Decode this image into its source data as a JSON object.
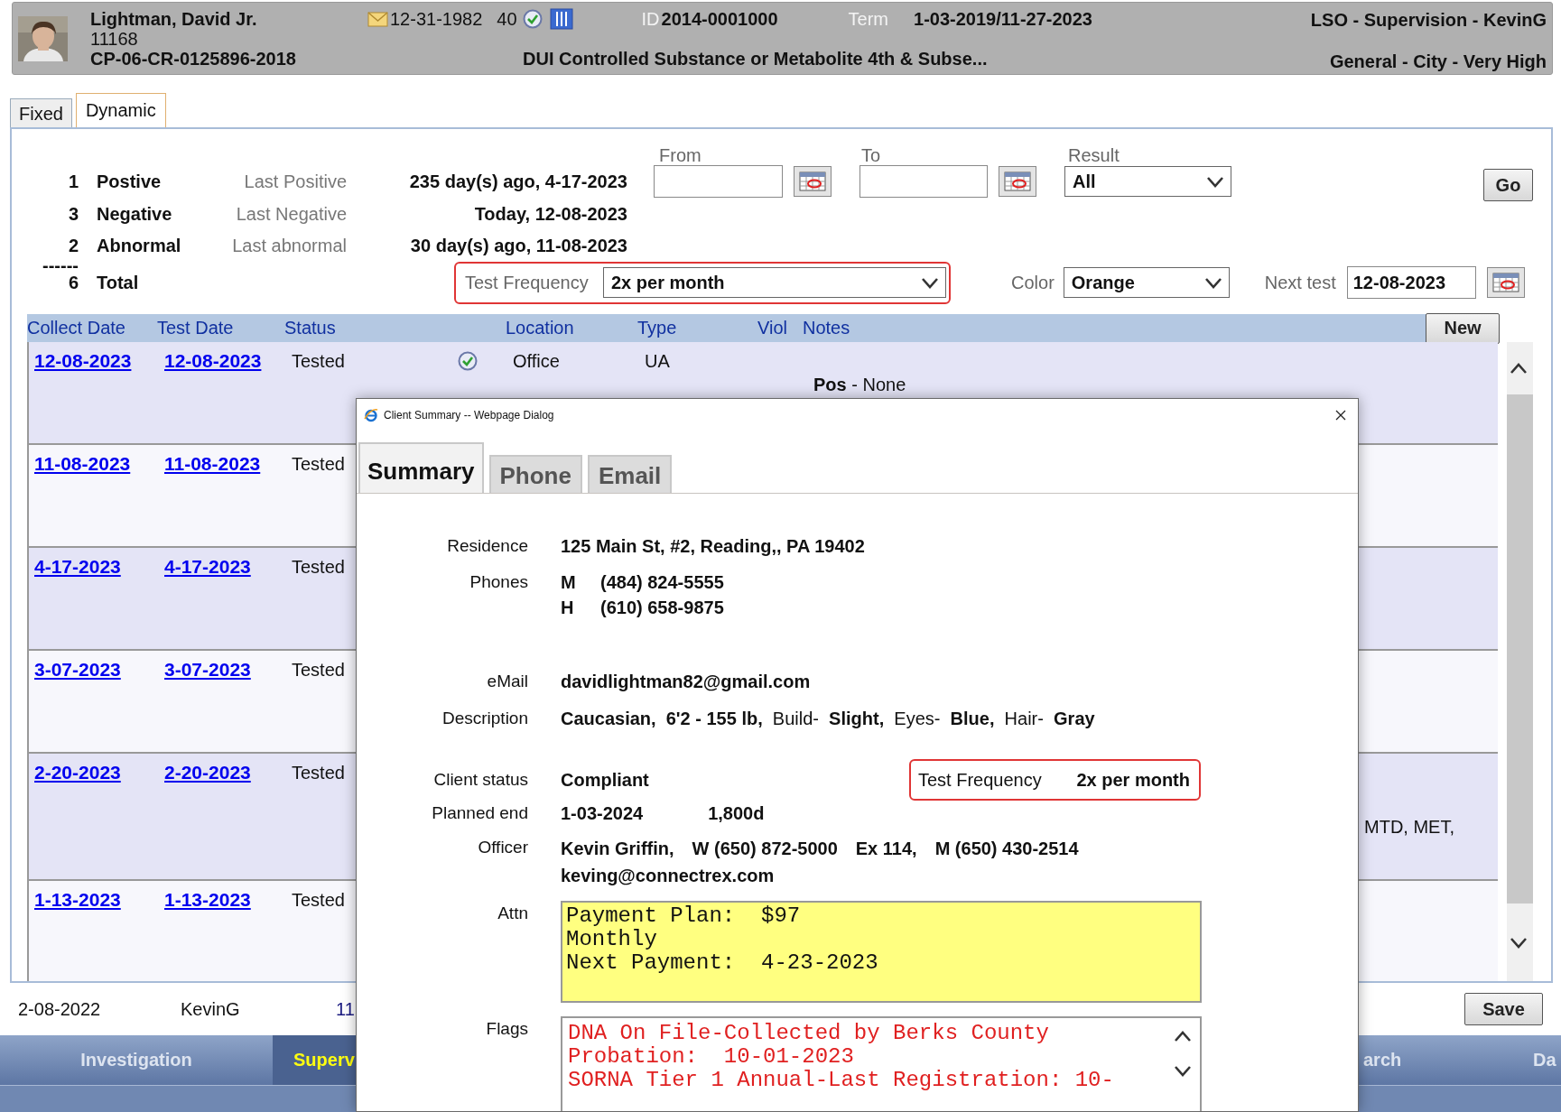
{
  "header": {
    "name": "Lightman, David Jr.",
    "number": "11168",
    "case_number": "CP-06-CR-0125896-2018",
    "birth_date": "12-31-1982",
    "age": "40",
    "id_label": "ID",
    "id": "2014-0001000",
    "term_label": "Term",
    "term": "1-03-2019/11-27-2023",
    "assignment": "LSO - Supervision - KevinG",
    "offense": "DUI Controlled Substance or Metabolite 4th & Subse...",
    "classification": "General - City - Very High"
  },
  "tabs": [
    {
      "label": "Fixed",
      "selected": false
    },
    {
      "label": "Dynamic",
      "selected": true
    }
  ],
  "stats": [
    {
      "count": "1",
      "label": "Postive",
      "last_label": "Last Positive",
      "last_value": "235 day(s) ago, 4-17-2023"
    },
    {
      "count": "3",
      "label": "Negative",
      "last_label": "Last Negative",
      "last_value": "Today, 12-08-2023"
    },
    {
      "count": "2",
      "label": "Abnormal",
      "last_label": "Last abnormal",
      "last_value": "30 day(s) ago, 11-08-2023"
    }
  ],
  "total": {
    "rule": "------",
    "count": "6",
    "label": "Total"
  },
  "filters": {
    "from": {
      "label": "From"
    },
    "to": {
      "label": "To"
    },
    "result": {
      "label": "Result",
      "value": "All"
    },
    "go_button": "Go",
    "test_frequency": {
      "label": "Test Frequency",
      "value": "2x per month",
      "highlighted": true
    },
    "color": {
      "label": "Color",
      "value": "Orange"
    },
    "next_test": {
      "label": "Next test",
      "value": "12-08-2023"
    }
  },
  "table": {
    "columns": [
      "Collect Date",
      "Test Date",
      "Status",
      "Location",
      "Type",
      "Viol",
      "Notes"
    ],
    "new_button": "New",
    "rows": [
      {
        "collect_date": "12-08-2023",
        "test_date": "12-08-2023",
        "status": "Tested",
        "verified": true,
        "location": "Office",
        "type": "UA",
        "notes": "**Pos** - None"
      },
      {
        "collect_date": "11-08-2023",
        "test_date": "11-08-2023",
        "status": "Tested"
      },
      {
        "collect_date": "4-17-2023",
        "test_date": "4-17-2023",
        "status": "Tested"
      },
      {
        "collect_date": "3-07-2023",
        "test_date": "3-07-2023",
        "status": "Tested"
      },
      {
        "collect_date": "2-20-2023",
        "test_date": "2-20-2023",
        "status": "Tested",
        "notes_tail": "MTD, MET,"
      },
      {
        "collect_date": "1-13-2023",
        "test_date": "1-13-2023",
        "status": "Tested"
      }
    ]
  },
  "footer_row": {
    "date": "2-08-2022",
    "user": "KevinG",
    "column_3": "11"
  },
  "save_button": "Save",
  "nav": [
    {
      "label": "Investigation",
      "selected": false
    },
    {
      "label": "Superv",
      "selected": true
    },
    {
      "label": "arch",
      "selected": false
    },
    {
      "label": "Da",
      "selected": false
    }
  ],
  "dialog": {
    "title": "Client Summary -- Webpage Dialog",
    "tabs": [
      {
        "label": "Summary",
        "selected": true
      },
      {
        "label": "Phone",
        "selected": false
      },
      {
        "label": "Email",
        "selected": false
      }
    ],
    "residence": {
      "label": "Residence",
      "value": "125 Main St, #2, Reading,, PA 19402"
    },
    "phones": {
      "label": "Phones",
      "items": [
        {
          "type": "M",
          "number": "(484) 824-5555"
        },
        {
          "type": "H",
          "number": "(610) 658-9875"
        }
      ]
    },
    "email": {
      "label": "eMail",
      "value": "davidlightman82@gmail.com"
    },
    "description": {
      "label": "Description",
      "value": "**Caucasian,  6'2 - 155 lb,**  Build-  **Slight,**  Eyes-  **Blue,**  Hair-  **Gray**"
    },
    "client_status": {
      "label": "Client status",
      "value": "Compliant"
    },
    "test_frequency": {
      "label": "Test Frequency",
      "value": "2x per month",
      "highlighted": true
    },
    "planned_end": {
      "label": "Planned end",
      "date": "1-03-2024",
      "days": "1,800d"
    },
    "officer": {
      "label": "Officer",
      "parts": [
        "Kevin Griffin,",
        "W (650) 872-5000",
        "Ex 114,",
        "M (650) 430-2514"
      ],
      "email": "keving@connectrex.com"
    },
    "attn": {
      "label": "Attn",
      "lines": [
        "Payment Plan:  $97",
        "Monthly",
        "Next Payment:  4-23-2023"
      ]
    },
    "flags": {
      "label": "Flags",
      "lines": [
        "DNA On File-Collected by Berks County",
        "Probation:  10-01-2023",
        "SORNA Tier 1 Annual-Last Registration: 10-"
      ]
    }
  }
}
